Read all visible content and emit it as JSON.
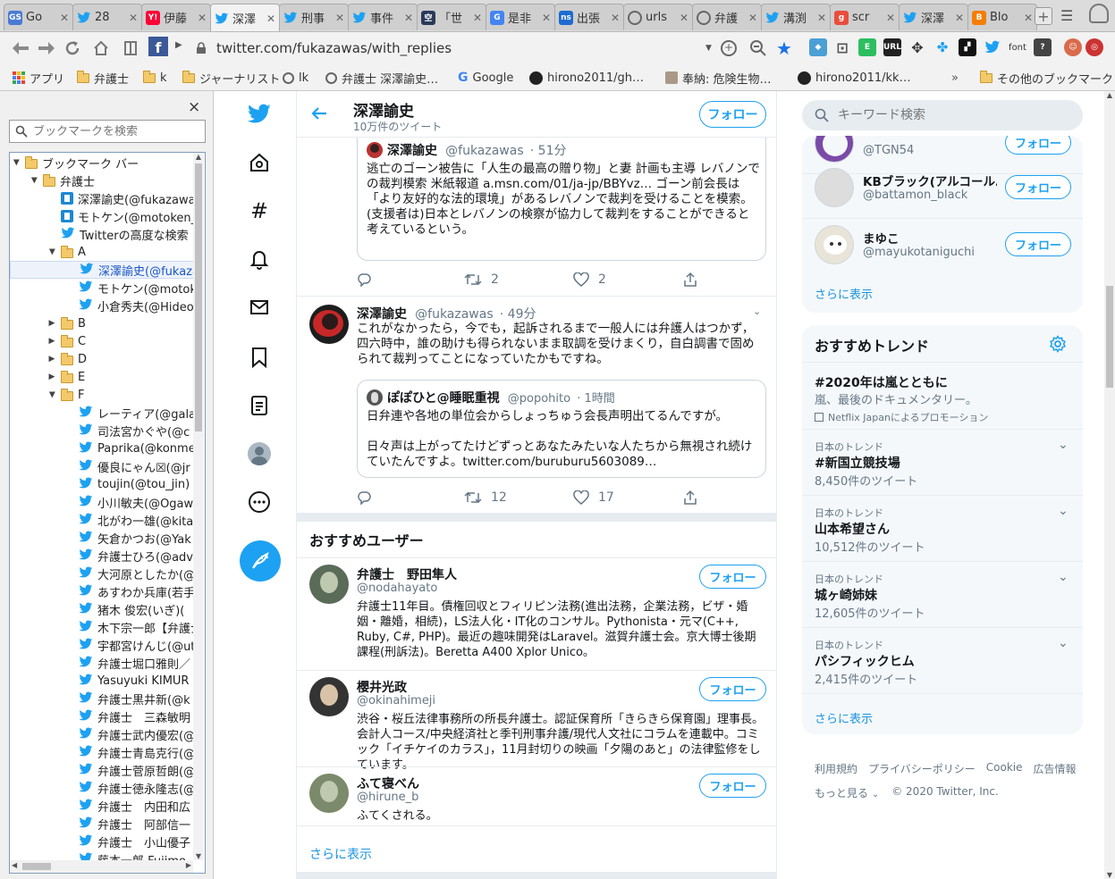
{
  "tabs": [
    {
      "label": "Go",
      "fav": "GS",
      "color": "#4a7bd4"
    },
    {
      "label": "28",
      "fav": "tw",
      "color": "#1da1f2"
    },
    {
      "label": "伊藤",
      "fav": "Y!",
      "color": "#ff0033"
    },
    {
      "label": "深澤",
      "fav": "tw",
      "color": "#1da1f2"
    },
    {
      "label": "刑事",
      "fav": "tw",
      "color": "#1da1f2"
    },
    {
      "label": "事件",
      "fav": "tw",
      "color": "#1da1f2"
    },
    {
      "label": "「世",
      "fav": "空",
      "color": "#2b3a5a"
    },
    {
      "label": "是非",
      "fav": "G",
      "color": "#4285f4"
    },
    {
      "label": "出張",
      "fav": "ns",
      "color": "#1e6bd0"
    },
    {
      "label": "urls",
      "fav": "globe",
      "color": "#666666"
    },
    {
      "label": "弁護",
      "fav": "globe",
      "color": "#666666"
    },
    {
      "label": "溝渕",
      "fav": "tw",
      "color": "#1da1f2"
    },
    {
      "label": "scr",
      "fav": "g",
      "color": "#e94e3c"
    },
    {
      "label": "深澤",
      "fav": "tw",
      "color": "#1da1f2"
    },
    {
      "label": "Blo",
      "fav": "B",
      "color": "#f57d00"
    }
  ],
  "url": "twitter.com/fukazawas/with_replies",
  "bookmarks_bar": [
    {
      "label": "アプリ",
      "icon": "apps-icon"
    },
    {
      "label": "弁護士",
      "icon": "folder-icon"
    },
    {
      "label": "k",
      "icon": "folder-icon"
    },
    {
      "label": "ジャーナリスト",
      "icon": "folder-icon"
    },
    {
      "label": "lk",
      "icon": "globe-icon"
    },
    {
      "label": "弁護士 深澤諭史…",
      "icon": "globe-icon"
    },
    {
      "label": "Google",
      "icon": "google-icon"
    },
    {
      "label": "hirono2011/gh…",
      "icon": "github-icon"
    },
    {
      "label": "奉納: 危険生物…",
      "icon": "page-icon"
    },
    {
      "label": "hirono2011/kk…",
      "icon": "github-icon"
    }
  ],
  "bookmarks_more": "»",
  "bookmarks_other": "その他のブックマーク",
  "sidebar": {
    "close": "×",
    "search_placeholder": "ブックマークを検索",
    "tree": [
      {
        "label": "ブックマーク バー",
        "type": "folder",
        "depth": 0,
        "open": true
      },
      {
        "label": "弁護士",
        "type": "folder",
        "depth": 1,
        "open": true
      },
      {
        "label": "深澤諭史(@fukazawas)",
        "type": "page",
        "depth": 2
      },
      {
        "label": "モトケン(@motoken_tw)",
        "type": "page",
        "depth": 2
      },
      {
        "label": "Twitterの高度な検索",
        "type": "bird",
        "depth": 2
      },
      {
        "label": "A",
        "type": "folder",
        "depth": 2,
        "open": true
      },
      {
        "label": "深澤諭史(@fukazawas)",
        "type": "bird",
        "depth": 3,
        "selected": true
      },
      {
        "label": "モトケン(@motoken_tw)",
        "type": "bird",
        "depth": 3
      },
      {
        "label": "小倉秀夫(@Hideo_Ogura)",
        "type": "bird",
        "depth": 3
      },
      {
        "label": "B",
        "type": "folder",
        "depth": 2,
        "open": false
      },
      {
        "label": "C",
        "type": "folder",
        "depth": 2,
        "open": false
      },
      {
        "label": "D",
        "type": "folder",
        "depth": 2,
        "open": false
      },
      {
        "label": "E",
        "type": "folder",
        "depth": 2,
        "open": false
      },
      {
        "label": "F",
        "type": "folder",
        "depth": 2,
        "open": true
      },
      {
        "label": "レーティア(@galac",
        "type": "bird",
        "depth": 3
      },
      {
        "label": "司法宮かぐや(@c",
        "type": "bird",
        "depth": 3
      },
      {
        "label": "Paprika(@konme",
        "type": "bird",
        "depth": 3
      },
      {
        "label": "優良にゃん☒(@jr",
        "type": "bird",
        "depth": 3
      },
      {
        "label": "toujin(@tou_jin)",
        "type": "bird",
        "depth": 3
      },
      {
        "label": "小川敏夫(@Ogaw",
        "type": "bird",
        "depth": 3
      },
      {
        "label": "北がわ一雄(@kita",
        "type": "bird",
        "depth": 3
      },
      {
        "label": "矢倉かつお(@Yak",
        "type": "bird",
        "depth": 3
      },
      {
        "label": "弁護士ひろ(@adv",
        "type": "bird",
        "depth": 3
      },
      {
        "label": "大河原としたか(@",
        "type": "bird",
        "depth": 3
      },
      {
        "label": "あすわか兵庫(若手",
        "type": "bird",
        "depth": 3
      },
      {
        "label": "猪木 俊宏(いぎ)(",
        "type": "bird",
        "depth": 3
      },
      {
        "label": "木下宗一郎【弁護士",
        "type": "bird",
        "depth": 3
      },
      {
        "label": "宇都宮けんじ(@ut",
        "type": "bird",
        "depth": 3
      },
      {
        "label": "弁護士堀口雅則／",
        "type": "bird",
        "depth": 3
      },
      {
        "label": "Yasuyuki KIMUR",
        "type": "bird",
        "depth": 3
      },
      {
        "label": "弁護士黒井新(@k",
        "type": "bird",
        "depth": 3
      },
      {
        "label": "弁護士　三森敏明",
        "type": "bird",
        "depth": 3
      },
      {
        "label": "弁護士武内優宏(@",
        "type": "bird",
        "depth": 3
      },
      {
        "label": "弁護士青島克行(@",
        "type": "bird",
        "depth": 3
      },
      {
        "label": "弁護士菅原哲朗(@",
        "type": "bird",
        "depth": 3
      },
      {
        "label": "弁護士徳永隆志(@",
        "type": "bird",
        "depth": 3
      },
      {
        "label": "弁護士　内田和広",
        "type": "bird",
        "depth": 3
      },
      {
        "label": "弁護士　阿部信一",
        "type": "bird",
        "depth": 3
      },
      {
        "label": "弁護士　小山優子",
        "type": "bird",
        "depth": 3
      },
      {
        "label": "藤本一郎 Fujimo",
        "type": "bird",
        "depth": 3
      }
    ]
  },
  "profile": {
    "name": "深澤諭史",
    "tweets": "10万件のツイート",
    "follow": "フォロー"
  },
  "tweet1": {
    "quote_name": "深澤諭史",
    "quote_handle": "@fukazawas",
    "quote_time": "· 51分",
    "quote_text": "逃亡のゴーン被告に「人生の最高の贈り物」と妻 計画も主導 レバノンでの裁判模索 米紙報道 a.msn.com/01/ja-jp/BBYvz… ゴーン前会長は「より友好的な法的環境」があるレバノンで裁判を受けることを模索。 (支援者は)日本とレバノンの検察が協力して裁判をすることができると考えているという。",
    "retweets": "2",
    "likes": "2"
  },
  "tweet2": {
    "name": "深澤諭史",
    "handle": "@fukazawas",
    "time": "· 49分",
    "text": "これがなかったら，今でも，起訴されるまで一般人には弁護人はつかず，四六時中，誰の助けも得られないまま取調を受けまくり，自白調書で固められて裁判ってことになっていたかもですね。",
    "quote_name": "ぽぽひと@睡眠重視",
    "quote_handle": "@popohito",
    "quote_time": "· 1時間",
    "quote_text1": "日弁連や各地の単位会からしょっちゅう会長声明出てるんですが。",
    "quote_text2": "日々声は上がってたけどずっとあなたみたいな人たちから無視され続けていたんですよ。twitter.com/buruburu5603089…",
    "retweets": "12",
    "likes": "17"
  },
  "suggested": {
    "title": "おすすめユーザー",
    "more": "さらに表示",
    "users": [
      {
        "name": "弁護士　野田隼人",
        "handle": "@nodahayato",
        "bio": "弁護士11年目。債権回収とフィリピン法務(進出法務，企業法務，ビザ・婚姻・離婚，相続)，LS法人化・IT化のコンサル。Pythonista・元マ(C++, Ruby, C#, PHP)。最近の趣味開発はLaravel。滋賀弁護士会。京大博士後期課程(刑訴法)。Beretta A400 Xplor Unico。"
      },
      {
        "name": "櫻井光政",
        "handle": "@okinahimeji",
        "bio": "渋谷・桜丘法律事務所の所長弁護士。認証保育所「きらきら保育園」理事長。会計人コース/中央経済社と季刊刑事弁護/現代人文社にコラムを連載中。コミック「イチケイのカラス」，11月封切りの映画「夕陽のあと」の法律監修をしています。"
      },
      {
        "name": "ふて寝べん",
        "handle": "@hirune_b",
        "bio": "ふてくされる。"
      }
    ]
  },
  "right": {
    "search_placeholder": "キーワード検索",
    "who_to_follow": [
      {
        "name": "",
        "handle": "@TGN54"
      },
      {
        "name": "KBブラック(アルコール…",
        "handle": "@battamon_black"
      },
      {
        "name": "まゆこ",
        "handle": "@mayukotaniguchi"
      }
    ],
    "wtf_more": "さらに表示",
    "trends_title": "おすすめトレンド",
    "promoted": {
      "tag": "#2020年は嵐とともに",
      "desc": "嵐、最後のドキュメンタリー。",
      "by": "Netflix Japanによるプロモーション"
    },
    "trends": [
      {
        "context": "日本のトレンド",
        "name": "#新国立競技場",
        "count": "8,450件のツイート"
      },
      {
        "context": "日本のトレンド",
        "name": "山本希望さん",
        "count": "10,512件のツイート"
      },
      {
        "context": "日本のトレンド",
        "name": "城ヶ崎姉妹",
        "count": "12,605件のツイート"
      },
      {
        "context": "日本のトレンド",
        "name": "パシフィックヒム",
        "count": "2,415件のツイート"
      }
    ],
    "trends_more": "さらに表示",
    "footer": [
      "利用規約",
      "プライバシーポリシー",
      "Cookie",
      "広告情報"
    ],
    "footer_more": "もっと見る",
    "copyright": "© 2020 Twitter, Inc."
  },
  "colors": {
    "twitter_blue": "#1da1f2",
    "link_blue": "#1b95e0",
    "grey_text": "#657786"
  }
}
